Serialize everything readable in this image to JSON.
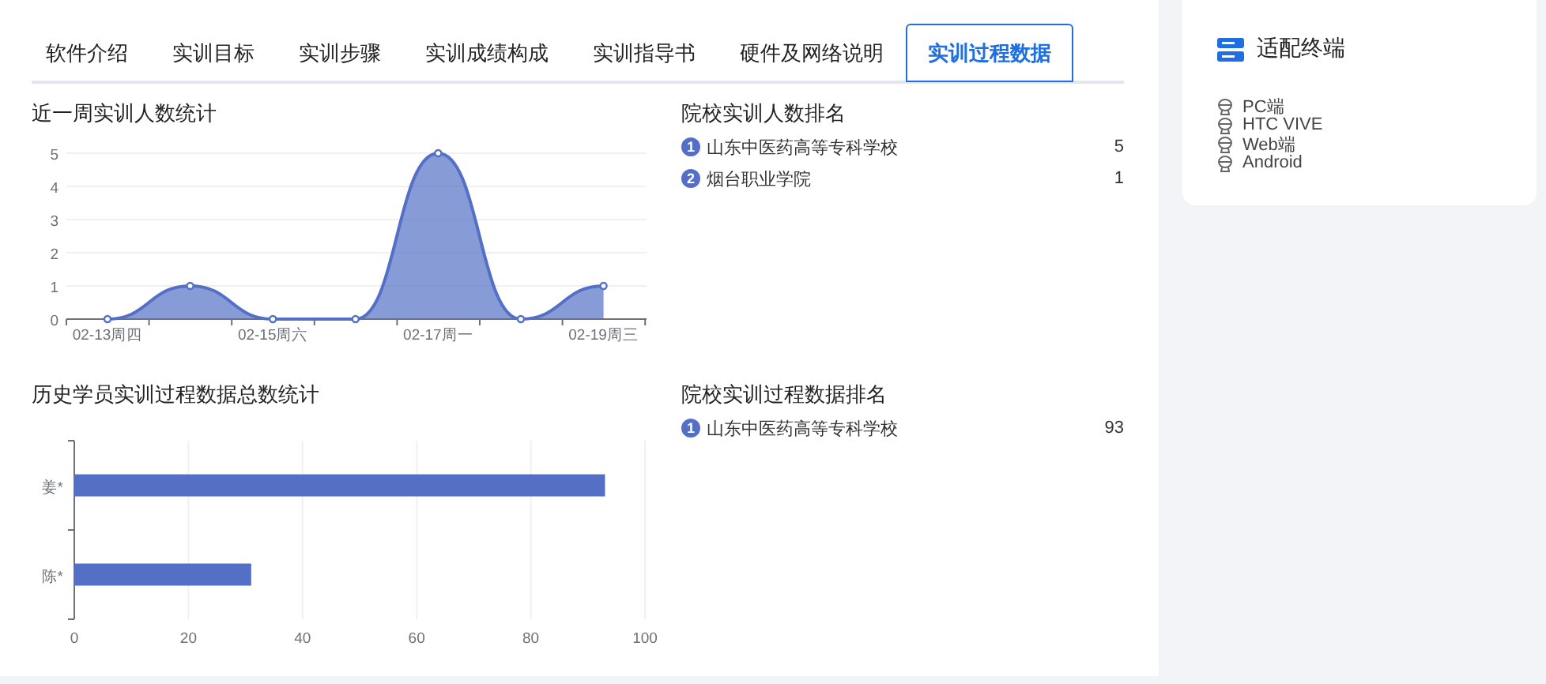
{
  "tabs": [
    {
      "label": "软件介绍",
      "selected": false
    },
    {
      "label": "实训目标",
      "selected": false
    },
    {
      "label": "实训步骤",
      "selected": false
    },
    {
      "label": "实训成绩构成",
      "selected": false
    },
    {
      "label": "实训指导书",
      "selected": false
    },
    {
      "label": "硬件及网络说明",
      "selected": false
    },
    {
      "label": "实训过程数据",
      "selected": true
    }
  ],
  "trend_chart": {
    "title": "近一周实训人数统计",
    "chart_data": {
      "type": "area",
      "categories": [
        "02-13周四",
        null,
        "02-15周六",
        null,
        "02-17周一",
        null,
        "02-19周三"
      ],
      "grid": true,
      "ylim": [
        0,
        5
      ],
      "yticks": [
        0,
        1,
        2,
        3,
        4,
        5
      ],
      "series": [
        {
          "color": "#5470c6",
          "values": [
            0,
            1,
            0,
            0,
            5,
            0,
            1
          ]
        }
      ]
    }
  },
  "user_ranking": {
    "title": "院校实训人数排名",
    "rows": [
      {
        "rank": "1",
        "name": "山东中医药高等专科学校",
        "value": "5"
      },
      {
        "rank": "2",
        "name": "烟台职业学院",
        "value": "1"
      }
    ]
  },
  "history_chart": {
    "title": "历史学员实训过程数据总数统计",
    "chart_data": {
      "type": "bar",
      "orientation": "horizontal",
      "categories": [
        "姜*",
        "陈*"
      ],
      "xlim": [
        0,
        100
      ],
      "xticks": [
        0,
        20,
        40,
        60,
        80,
        100
      ],
      "grid": true,
      "series": [
        {
          "color": "#5470c6",
          "values": [
            93,
            31
          ]
        }
      ]
    }
  },
  "process_ranking": {
    "title": "院校实训过程数据排名",
    "rows": [
      {
        "rank": "1",
        "name": "山东中医药高等专科学校",
        "value": "93"
      }
    ]
  },
  "terminals": {
    "title": "适配终端",
    "items": [
      "PC端",
      "HTC VIVE",
      "Web端",
      "Android"
    ]
  }
}
